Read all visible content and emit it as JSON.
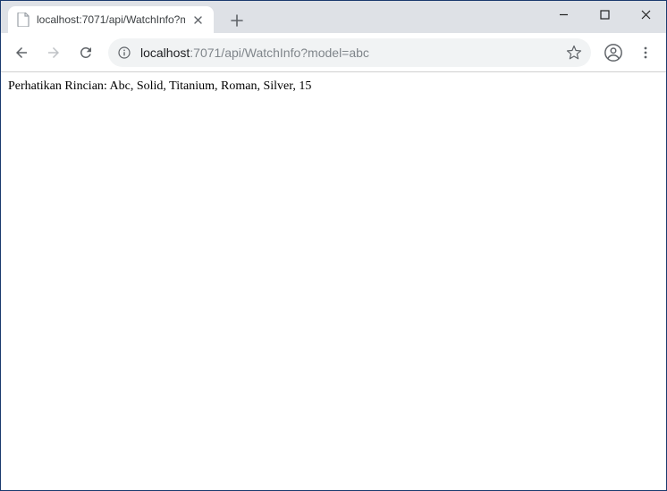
{
  "tab": {
    "title": "localhost:7071/api/WatchInfo?m"
  },
  "url": {
    "host": "localhost",
    "rest": ":7071/api/WatchInfo?model=abc"
  },
  "page": {
    "body_text": "Perhatikan Rincian: Abc, Solid, Titanium, Roman, Silver, 15"
  }
}
